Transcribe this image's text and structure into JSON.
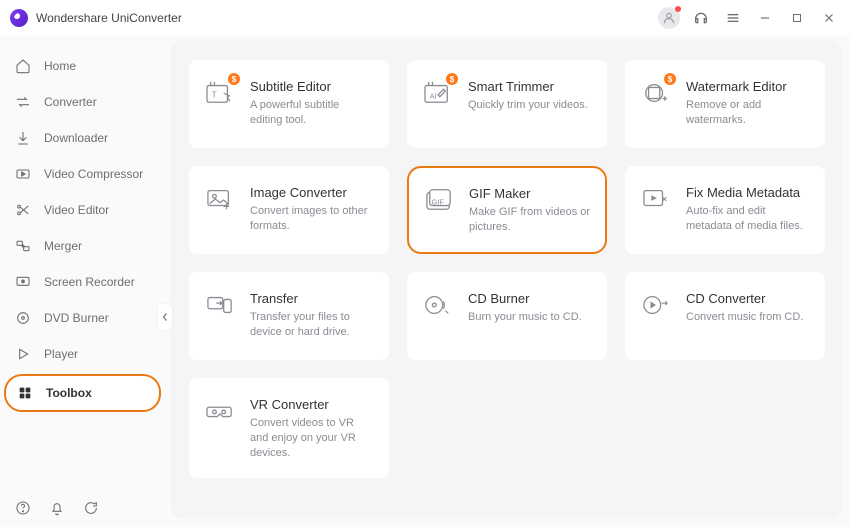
{
  "app": {
    "title": "Wondershare UniConverter"
  },
  "sidebar": {
    "items": [
      {
        "label": "Home"
      },
      {
        "label": "Converter"
      },
      {
        "label": "Downloader"
      },
      {
        "label": "Video Compressor"
      },
      {
        "label": "Video Editor"
      },
      {
        "label": "Merger"
      },
      {
        "label": "Screen Recorder"
      },
      {
        "label": "DVD Burner"
      },
      {
        "label": "Player"
      },
      {
        "label": "Toolbox"
      }
    ]
  },
  "tools": [
    {
      "title": "Subtitle Editor",
      "desc": "A powerful subtitle editing tool.",
      "paid": true
    },
    {
      "title": "Smart Trimmer",
      "desc": "Quickly trim your videos.",
      "paid": true
    },
    {
      "title": "Watermark Editor",
      "desc": "Remove or add watermarks.",
      "paid": true
    },
    {
      "title": "Image Converter",
      "desc": "Convert images to other formats.",
      "paid": false
    },
    {
      "title": "GIF Maker",
      "desc": "Make GIF from videos or pictures.",
      "paid": false
    },
    {
      "title": "Fix Media Metadata",
      "desc": "Auto-fix and edit metadata of media files.",
      "paid": false
    },
    {
      "title": "Transfer",
      "desc": "Transfer your files to device or hard drive.",
      "paid": false
    },
    {
      "title": "CD Burner",
      "desc": "Burn your music to CD.",
      "paid": false
    },
    {
      "title": "CD Converter",
      "desc": "Convert music from CD.",
      "paid": false
    },
    {
      "title": "VR Converter",
      "desc": "Convert videos to VR and enjoy on your VR devices.",
      "paid": false
    }
  ],
  "highlight": {
    "sidebar_active_index": 9,
    "tool_highlight_index": 4
  },
  "badges": {
    "dollar": "$"
  }
}
